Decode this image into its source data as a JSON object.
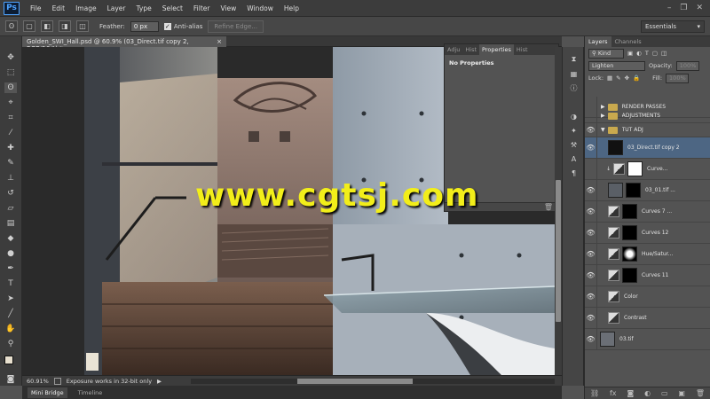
{
  "app": {
    "logo": "Ps"
  },
  "menu": [
    "File",
    "Edit",
    "Image",
    "Layer",
    "Type",
    "Select",
    "Filter",
    "View",
    "Window",
    "Help"
  ],
  "window_controls": [
    "–",
    "❐",
    "✕"
  ],
  "options": {
    "feather_label": "Feather:",
    "feather_value": "0 px",
    "antialias_label": "Anti-alias",
    "refine_edge": "Refine Edge...",
    "workspace": "Essentials"
  },
  "document": {
    "tab_title": "Golden_SWI_Hall.psd @ 60.9% (03_Direct.tif copy 2, RGB/16#) *",
    "close": "×"
  },
  "properties": {
    "tabs": [
      "Adju",
      "Hist",
      "Properties",
      "Hist"
    ],
    "body": "No Properties"
  },
  "status": {
    "zoom": "60.91%",
    "message": "Exposure works in 32-bit only",
    "arrow": "▶"
  },
  "bottom_tabs": [
    "Mini Bridge",
    "Timeline"
  ],
  "layers_panel": {
    "tabs": [
      "Layers",
      "Channels"
    ],
    "filter_kind": "Kind",
    "blend_mode": "Lighten",
    "opacity_label": "Opacity:",
    "opacity_value": "100%",
    "lock_label": "Lock:",
    "fill_label": "Fill:",
    "fill_value": "100%",
    "layers": [
      {
        "name": "RENDER PASSES",
        "kind": "group"
      },
      {
        "name": "ADJUSTMENTS",
        "kind": "group"
      },
      {
        "name": "TUT ADJ",
        "kind": "group-open"
      },
      {
        "name": "03_Direct.tif copy 2",
        "kind": "pixel"
      },
      {
        "name": "Curve...",
        "kind": "adjust"
      },
      {
        "name": "03_01.tif ...",
        "kind": "pixel"
      },
      {
        "name": "Curves 7 ...",
        "kind": "adjust"
      },
      {
        "name": "Curves 12",
        "kind": "adjust"
      },
      {
        "name": "Hue/Satur...",
        "kind": "adjust"
      },
      {
        "name": "Curves 11",
        "kind": "adjust"
      },
      {
        "name": "Color",
        "kind": "adjust-nomask"
      },
      {
        "name": "Contrast",
        "kind": "adjust-nomask"
      },
      {
        "name": "03.tif",
        "kind": "pixel"
      }
    ],
    "footer_icons": [
      "link-icon",
      "fx-icon",
      "mask-icon",
      "adjustment-icon",
      "folder-icon",
      "new-layer-icon",
      "trash-icon"
    ]
  },
  "watermark": "www.cgtsj.com"
}
